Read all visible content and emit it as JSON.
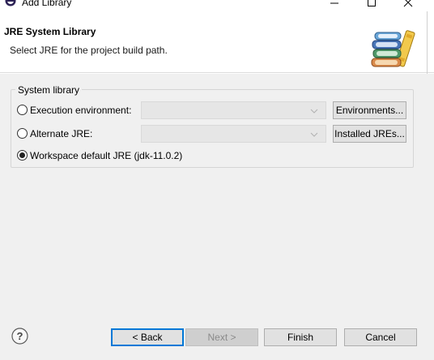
{
  "window": {
    "title": "Add Library",
    "icon": "eclipse-app-icon",
    "controls": [
      "minimize",
      "maximize",
      "close"
    ]
  },
  "banner": {
    "title": "JRE System Library",
    "message": "Select JRE for the project build path.",
    "image": "library-books-icon"
  },
  "system_library": {
    "group_label": "System library",
    "options": [
      {
        "label": "Execution environment:",
        "selected": false,
        "combo_value": "",
        "button": "Environments..."
      },
      {
        "label": "Alternate JRE:",
        "selected": false,
        "combo_value": "",
        "button": "Installed JREs..."
      },
      {
        "label": "Workspace default JRE (jdk-11.0.2)",
        "selected": true
      }
    ]
  },
  "footer": {
    "help_icon": "help-icon",
    "back": "< Back",
    "next": "Next >",
    "finish": "Finish",
    "cancel": "Cancel"
  },
  "colors": {
    "focus_border": "#0078d7",
    "dialog_bg": "#f0f0f0",
    "button_bg": "#e1e1e1"
  }
}
